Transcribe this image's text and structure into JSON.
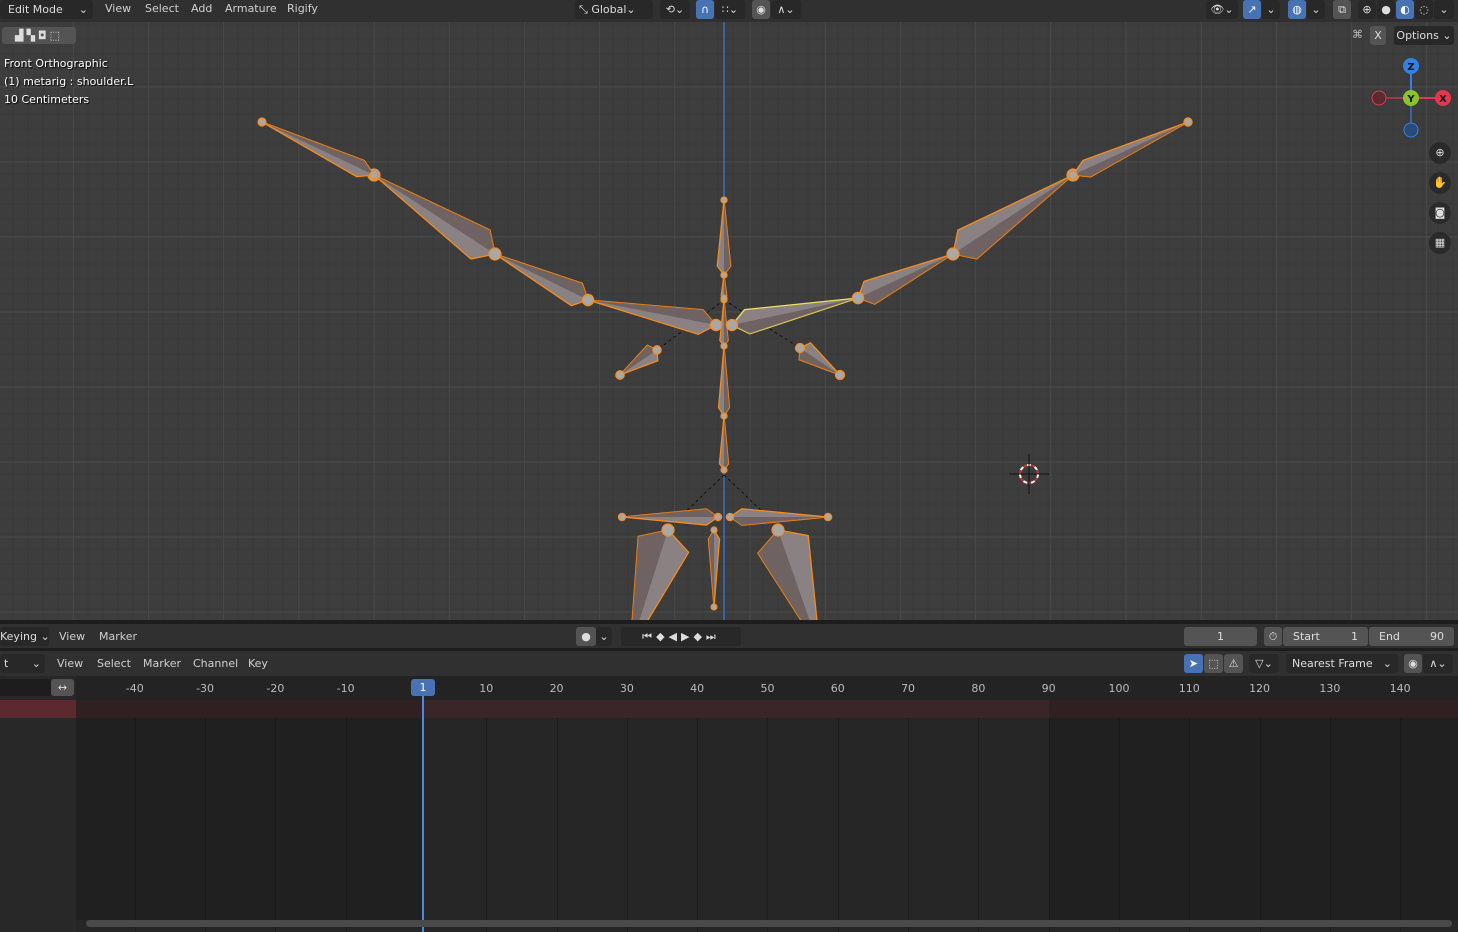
{
  "header": {
    "mode": "Edit Mode",
    "menus": [
      "View",
      "Select",
      "Add",
      "Armature",
      "Rigify"
    ],
    "transform_orientation": "Global",
    "options_label": "Options",
    "x_mirror": "X"
  },
  "viewport": {
    "view_name": "Front Orthographic",
    "active_object": "(1) metarig : shoulder.L",
    "scale": "10 Centimeters",
    "gizmo_axes": {
      "z": "Z",
      "y": "Y",
      "x": "X"
    },
    "colors": {
      "bone_fill": "#8a8282",
      "selected_outline": "#f58a1f",
      "active_outline": "#f0e060",
      "x_axis": "#e5364f",
      "y_axis": "#8bc32a",
      "z_axis": "#2f83e6"
    }
  },
  "timeline": {
    "keying": "Keying",
    "menus": [
      "View",
      "Marker"
    ],
    "current_frame": "1",
    "start_label": "Start",
    "start": "1",
    "end_label": "End",
    "end": "90"
  },
  "dopesheet": {
    "mode": "t",
    "menus": [
      "View",
      "Select",
      "Marker",
      "Channel",
      "Key"
    ],
    "snap": "Nearest Frame",
    "current_frame": "1",
    "ticks": [
      "-40",
      "-30",
      "-20",
      "-10",
      "10",
      "20",
      "30",
      "40",
      "50",
      "60",
      "70",
      "80",
      "90",
      "100",
      "110",
      "120",
      "130",
      "140"
    ]
  }
}
